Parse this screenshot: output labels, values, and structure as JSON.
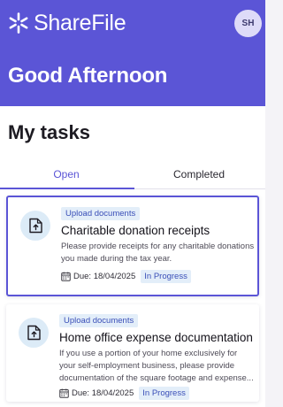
{
  "header": {
    "brand_name": "ShareFile",
    "avatar_initials": "SH",
    "greeting": "Good Afternoon",
    "background_color": "#5b55d6"
  },
  "section_title": "My tasks",
  "tabs": [
    {
      "label": "Open",
      "selected": true
    },
    {
      "label": "Completed",
      "selected": false
    }
  ],
  "tasks": [
    {
      "type_label": "Upload documents",
      "title": "Charitable donation receipts",
      "description": "Please provide receipts for any charitable donations you made during the tax year.",
      "due": "Due: 18/04/2025",
      "status": "In Progress",
      "icon": "upload-document-icon",
      "highlighted": true
    },
    {
      "type_label": "Upload documents",
      "title": "Home office expense documentation",
      "description": "If you use a portion of your home exclusively for your self-employment business, please provide documentation of the square footage and expense...",
      "due": "Due: 18/04/2025",
      "status": "In Progress",
      "icon": "upload-document-icon",
      "highlighted": false
    }
  ],
  "colors": {
    "accent": "#5b55d6",
    "badge_bg": "#e3eef9",
    "badge_text": "#3a4fb8"
  }
}
